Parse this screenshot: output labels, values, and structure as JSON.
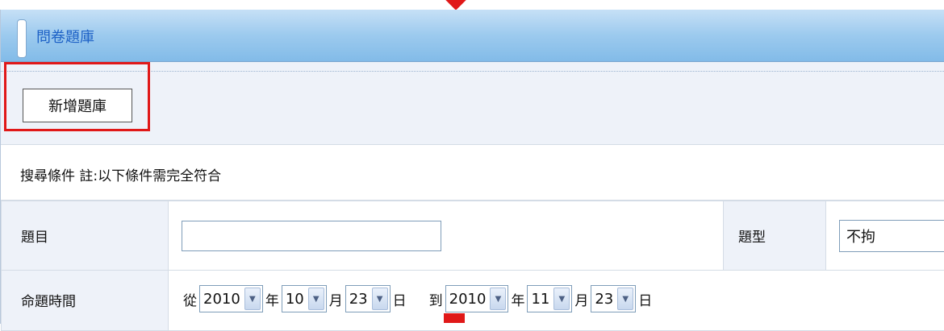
{
  "panel": {
    "title": "問卷題庫"
  },
  "toolbar": {
    "add_label": "新增題庫"
  },
  "search": {
    "header": "搜尋條件 註:以下條件需完全符合",
    "subject_label": "題目",
    "subject_value": "",
    "type_label": "題型",
    "type_value": "不拘",
    "time_label": "命題時間",
    "from_text": "從",
    "to_text": "到",
    "year_text": "年",
    "month_text": "月",
    "day_text": "日",
    "from": {
      "year": "2010",
      "month": "10",
      "day": "23"
    },
    "to": {
      "year": "2010",
      "month": "11",
      "day": "23"
    }
  },
  "colors": {
    "highlight": "#e01818",
    "title_text": "#1d61c6",
    "title_bar": "#9ccaee"
  },
  "icons": {
    "dropdown": "chevron-down-icon"
  }
}
